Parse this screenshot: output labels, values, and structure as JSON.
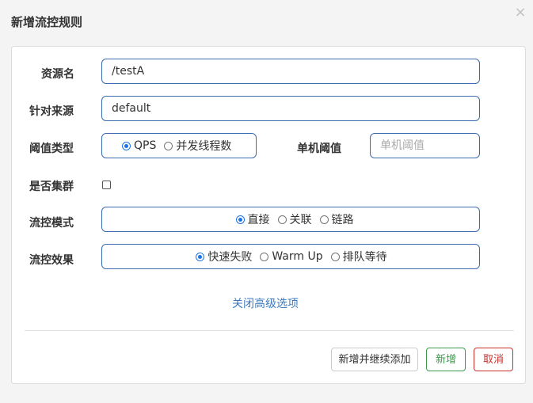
{
  "dialog": {
    "title": "新增流控规则",
    "close_glyph": "×"
  },
  "form": {
    "resource_name": {
      "label": "资源名",
      "value": "/testA"
    },
    "limit_app": {
      "label": "针对来源",
      "value": "default"
    },
    "threshold_type": {
      "label": "阈值类型",
      "options": [
        {
          "label": "QPS",
          "checked": true
        },
        {
          "label": "并发线程数",
          "checked": false
        }
      ]
    },
    "single_threshold": {
      "label": "单机阈值",
      "placeholder": "单机阈值"
    },
    "cluster_mode": {
      "label": "是否集群",
      "checked": false
    },
    "control_mode": {
      "label": "流控模式",
      "options": [
        {
          "label": "直接",
          "checked": true
        },
        {
          "label": "关联",
          "checked": false
        },
        {
          "label": "链路",
          "checked": false
        }
      ]
    },
    "control_effect": {
      "label": "流控效果",
      "options": [
        {
          "label": "快速失败",
          "checked": true
        },
        {
          "label": "Warm Up",
          "checked": false
        },
        {
          "label": "排队等待",
          "checked": false
        }
      ]
    },
    "advanced_toggle": "关闭高级选项"
  },
  "footer": {
    "add_continue_label": "新增并继续添加",
    "add_label": "新增",
    "cancel_label": "取消"
  },
  "colors": {
    "input_border": "#3c6bb0",
    "link": "#3c7bbf",
    "success": "#3c9a4a",
    "danger": "#c9302c"
  }
}
